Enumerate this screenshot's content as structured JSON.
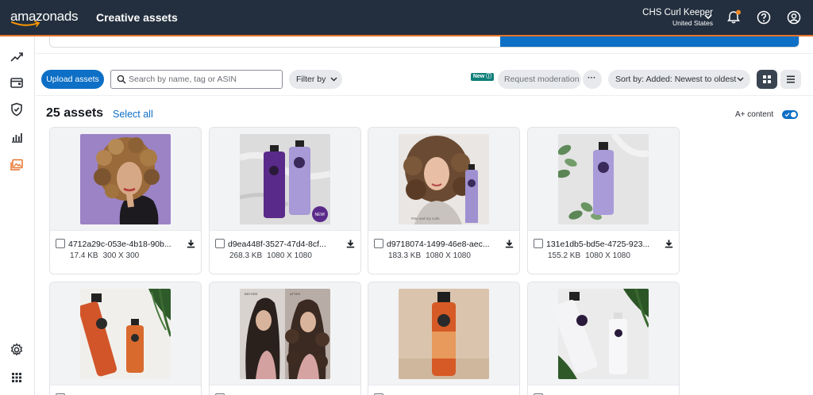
{
  "header": {
    "logo_text": "amazonads",
    "page_title": "Creative assets",
    "account_name": "CHS Curl Keeper",
    "account_country": "United States"
  },
  "colors": {
    "topbar": "#232f3e",
    "accent_orange": "#e8742b",
    "primary_blue": "#0d6fc5",
    "new_badge": "#0f7f7a"
  },
  "nav": {
    "items": [
      "trend-icon",
      "wallet-icon",
      "shield-icon",
      "bar-chart-icon",
      "creative-assets-icon"
    ],
    "bottom_items": [
      "settings-icon",
      "apps-grid-icon"
    ],
    "active": "creative-assets-icon"
  },
  "toolbar": {
    "upload_label": "Upload assets",
    "search_placeholder": "Search by name, tag or ASIN",
    "filter_label": "Filter by",
    "new_badge": "New",
    "request_moderation_label": "Request moderation",
    "more_label": "···",
    "sort_label": "Sort by: Added: Newest to oldest",
    "view_mode": "grid"
  },
  "listing": {
    "count_label": "25 assets",
    "select_all_label": "Select all",
    "aplus_label": "A+ content",
    "aplus_enabled": true
  },
  "assets": [
    {
      "name": "4712a29c-053e-4b18-90b...",
      "size": "17.4 KB",
      "dims": "300 X 300",
      "image": "model-with-curls-purple-background"
    },
    {
      "name": "d9ea448f-3527-47d4-8cf...",
      "size": "268.3 KB",
      "dims": "1080 X 1080",
      "image": "purple-shampoo-bottles-new-badge"
    },
    {
      "name": "d9718074-1499-46e8-aec...",
      "size": "183.3 KB",
      "dims": "1080 X 1080",
      "image": "woman-holding-purple-bottle"
    },
    {
      "name": "131e1db5-bd5e-4725-923...",
      "size": "155.2 KB",
      "dims": "1080 X 1080",
      "image": "purple-bottle-with-leaves"
    },
    {
      "name": "",
      "size": "",
      "dims": "",
      "image": "orange-bottles-with-palm"
    },
    {
      "name": "",
      "size": "",
      "dims": "",
      "image": "before-after-curls"
    },
    {
      "name": "",
      "size": "",
      "dims": "",
      "image": "orange-bottle-beige-background"
    },
    {
      "name": "",
      "size": "",
      "dims": "",
      "image": "white-bottles-with-palm"
    }
  ]
}
